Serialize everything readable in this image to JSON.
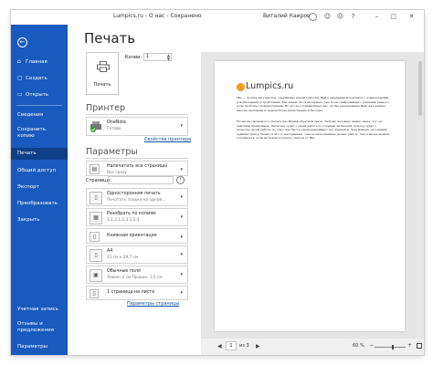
{
  "titlebar": {
    "title": "Lumpics.ru - О нас - Сохранено",
    "user": "Виталий Каиров"
  },
  "sidebar": {
    "items": [
      {
        "icon": "⌂",
        "label": "Главная"
      },
      {
        "icon": "▢",
        "label": "Создать"
      },
      {
        "icon": "▭",
        "label": "Открыть"
      },
      {
        "icon": "",
        "label": "Сведения"
      },
      {
        "icon": "",
        "label": "Сохранить копию"
      },
      {
        "icon": "",
        "label": "Печать"
      },
      {
        "icon": "",
        "label": "Общий доступ"
      },
      {
        "icon": "",
        "label": "Экспорт"
      },
      {
        "icon": "",
        "label": "Преобразовать"
      },
      {
        "icon": "",
        "label": "Закрыть"
      }
    ],
    "bottom_items": [
      {
        "label": "Учетная запись"
      },
      {
        "label": "Отзывы и предложения"
      },
      {
        "label": "Параметры"
      }
    ]
  },
  "main": {
    "title": "Печать",
    "print_button": "Печать",
    "copies_label": "Копии:",
    "copies_value": "1",
    "printer_heading": "Принтер",
    "printer": {
      "name": "OneNote",
      "status": "Готово"
    },
    "printer_properties_link": "Свойства принтера",
    "settings_heading": "Параметры",
    "settings": [
      {
        "l1": "Напечатать все страницы",
        "l2": "Все сразу"
      },
      {
        "l1": "Односторонняя печать",
        "l2": "Печатать только на одной..."
      },
      {
        "l1": "Разобрать по копиям",
        "l2": "1,2,3    1,2,3    1,2,3"
      },
      {
        "l1": "Книжная ориентация",
        "l2": ""
      },
      {
        "l1": "A4",
        "l2": "21 см x 29,7 см"
      },
      {
        "l1": "Обычные поля",
        "l2": "Левое: 3 см   Правое: 1,5 см"
      },
      {
        "l1": "1 страница на листе",
        "l2": ""
      }
    ],
    "pages_label": "Страницы:",
    "page_setup_link": "Параметры страницы"
  },
  "preview": {
    "logo": "Lumpics.ru",
    "paragraphs": [
      "Мы — группа энтузиастов, одержимых идеей помогать Вам в ежедневном контакте с компьютерами и мобильными устройствами. Мы знаем, что в интернете уже полно информации о решении разного рода проблем с компьютерами. Но это не останавливает нас, чтобы рассказывать Вам, как решать многие проблемы и задачи более качественно и быстрее.",
      "Но мы не сможем это сделать без Вашей обратной связи. Любому человеку важно знать, что его действия правильные. Писатель судит о своей работе по отзывам читателей. Доктор судит о качестве своей работы по тому, как быстро выздоравливают его пациенты. Чем меньше системный администратор бегает и что-то настраивает, тем он качественнее делает работу. Так и мы не можем улучшаться, если не будем получать ответов от Вас."
    ]
  },
  "bottom_bar": {
    "page_current": "1",
    "page_of": "из 3",
    "zoom": "60 %",
    "zoom_level_fraction": 0.6
  }
}
